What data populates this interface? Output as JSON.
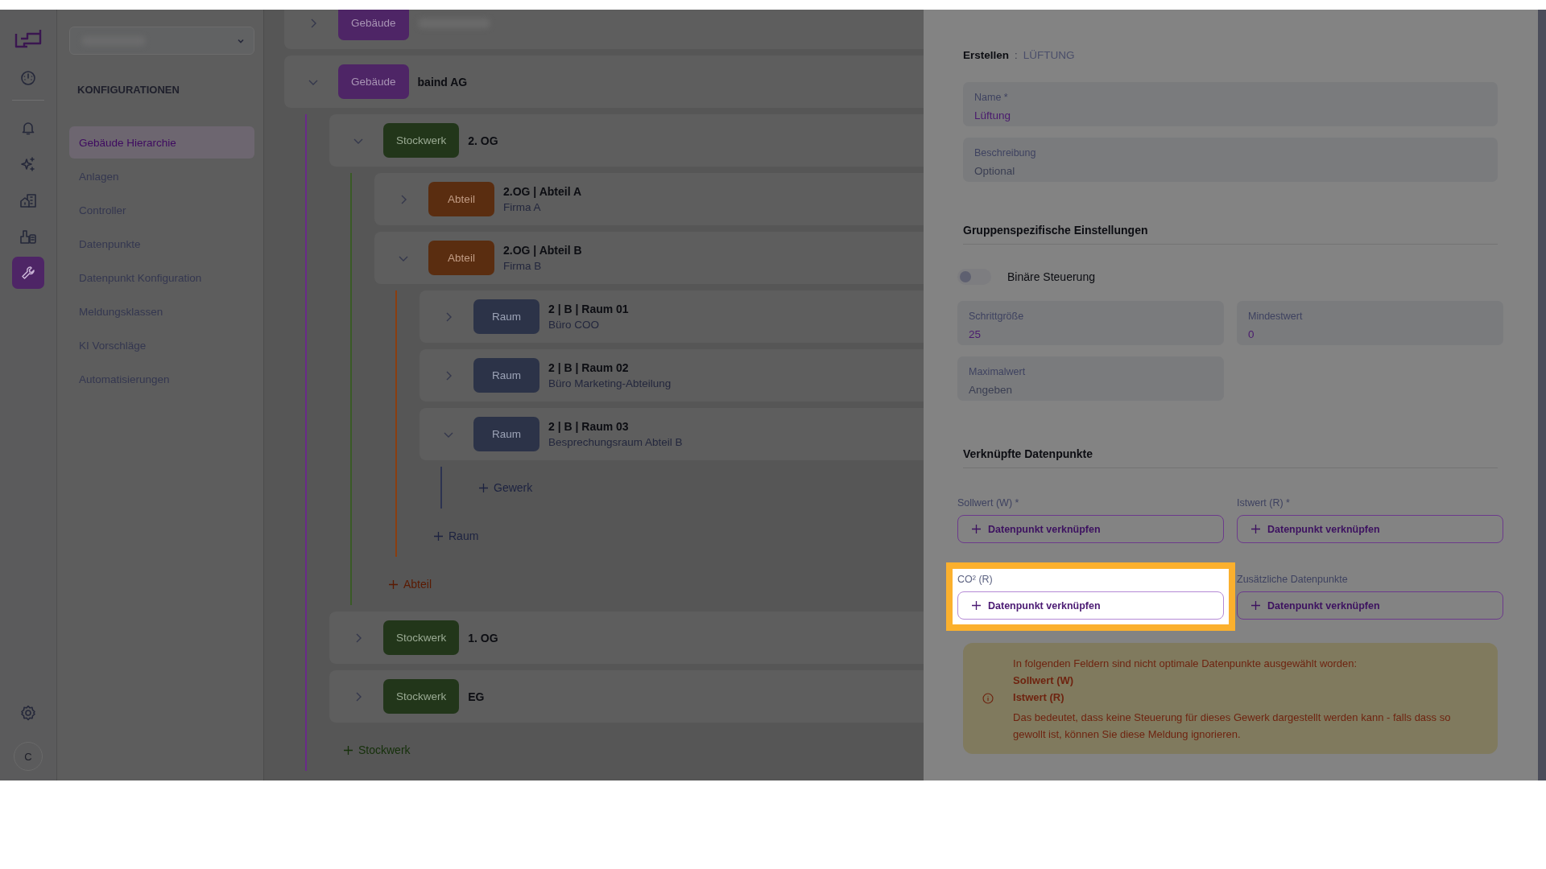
{
  "rail": {
    "items": [
      {
        "kind": "gauge",
        "selected": false
      },
      {
        "kind": "bell",
        "selected": false
      },
      {
        "kind": "sparkle",
        "selected": false
      },
      {
        "kind": "buildings",
        "selected": false
      },
      {
        "kind": "factory",
        "selected": false
      },
      {
        "kind": "wrench",
        "selected": true
      }
    ],
    "avatar": "C"
  },
  "sidebar": {
    "heading": "KONFIGURATIONEN",
    "items": [
      {
        "label": "Gebäude Hierarchie",
        "selected": true
      },
      {
        "label": "Anlagen",
        "selected": false
      },
      {
        "label": "Controller",
        "selected": false
      },
      {
        "label": "Datenpunkte",
        "selected": false
      },
      {
        "label": "Datenpunkt Konfiguration",
        "selected": false
      },
      {
        "label": "Meldungsklassen",
        "selected": false
      },
      {
        "label": "KI Vorschläge",
        "selected": false
      },
      {
        "label": "Automatisierungen",
        "selected": false
      }
    ]
  },
  "tree": {
    "nodes": [
      {
        "kind": "building",
        "badge": "Gebäude",
        "expanded": false
      },
      {
        "kind": "building",
        "badge": "Gebäude",
        "title": "baind AG",
        "expanded": true,
        "add_label": "Stockwerk",
        "children": [
          {
            "kind": "floor",
            "badge": "Stockwerk",
            "title": "2. OG",
            "expanded": true,
            "add_label": "Abteil",
            "children": [
              {
                "kind": "section",
                "badge": "Abteil",
                "title": "2.OG | Abteil A",
                "subtitle": "Firma A",
                "expanded": false
              },
              {
                "kind": "section",
                "badge": "Abteil",
                "title": "2.OG | Abteil B",
                "subtitle": "Firma B",
                "expanded": true,
                "add_label": "Raum",
                "children": [
                  {
                    "kind": "room",
                    "badge": "Raum",
                    "title": "2 | B | Raum 01",
                    "subtitle": "Büro COO",
                    "expanded": false
                  },
                  {
                    "kind": "room",
                    "badge": "Raum",
                    "title": "2 | B | Raum 02",
                    "subtitle": "Büro Marketing-Abteilung",
                    "expanded": false
                  },
                  {
                    "kind": "room",
                    "badge": "Raum",
                    "title": "2 | B | Raum 03",
                    "subtitle": "Besprechungsraum Abteil B",
                    "expanded": true,
                    "add_label": "Gewerk"
                  }
                ]
              }
            ]
          },
          {
            "kind": "floor",
            "badge": "Stockwerk",
            "title": "1. OG",
            "expanded": false
          },
          {
            "kind": "floor",
            "badge": "Stockwerk",
            "title": "EG",
            "expanded": false
          }
        ]
      }
    ]
  },
  "panel": {
    "breadcrumb": {
      "action": "Erstellen",
      "separator": ":",
      "type": "LÜFTUNG"
    },
    "name": {
      "label": "Name *",
      "value": "Lüftung"
    },
    "description": {
      "label": "Beschreibung",
      "placeholder": "Optional"
    },
    "group_heading": "Gruppenspezifische Einstellungen",
    "toggle": {
      "label": "Binäre Steuerung",
      "on": false
    },
    "settings": [
      {
        "label": "Schrittgröße",
        "value": "25"
      },
      {
        "label": "Mindestwert",
        "value": "0"
      },
      {
        "label": "Maximalwert",
        "placeholder": "Angeben"
      }
    ],
    "links_heading": "Verknüpfte Datenpunkte",
    "links": [
      {
        "label": "Sollwert (W) *",
        "button": "Datenpunkt verknüpfen",
        "highlighted": false
      },
      {
        "label": "Istwert (R) *",
        "button": "Datenpunkt verknüpfen",
        "highlighted": false
      },
      {
        "label": "CO² (R)",
        "button": "Datenpunkt verknüpfen",
        "highlighted": true
      },
      {
        "label": "Zusätzliche Datenpunkte",
        "button": "Datenpunkt verknüpfen",
        "highlighted": false
      }
    ],
    "warning": {
      "intro": "In folgenden Feldern sind nicht optimale Datenpunkte ausgewählt worden:",
      "fields": [
        "Sollwert (W)",
        "Istwert (R)"
      ],
      "note": "Das bedeutet, dass keine Steuerung für dieses Gewerk dargestellt werden kann - falls dass so gewollt ist, können Sie diese Meldung ignorieren."
    }
  }
}
